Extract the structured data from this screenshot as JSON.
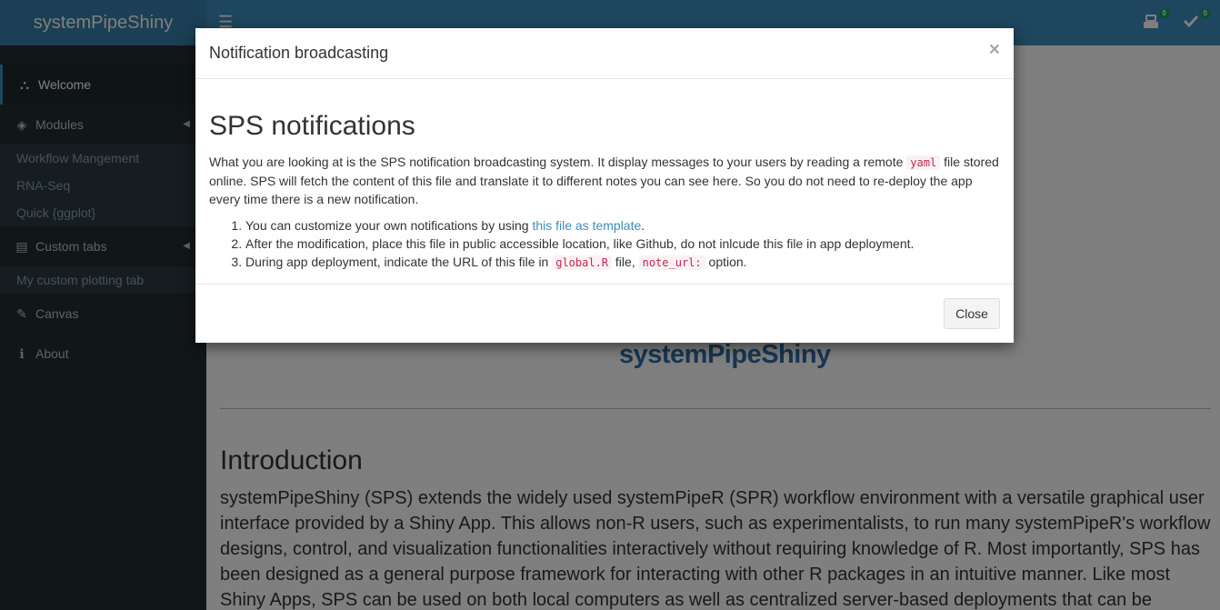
{
  "app": {
    "title": "systemPipeShiny"
  },
  "header": {
    "toggle_icon": "hamburger-icon",
    "notifications_badge": "0",
    "tasks_badge": "0"
  },
  "sidebar": {
    "items": [
      {
        "label": "Welcome",
        "icon": "sitemap-icon",
        "active": true
      },
      {
        "label": "Modules",
        "icon": "layers-icon"
      },
      {
        "label": "Custom tabs",
        "icon": "images-icon"
      },
      {
        "label": "Canvas",
        "icon": "paintbrush-icon"
      },
      {
        "label": "About",
        "icon": "info-icon"
      }
    ],
    "modules_sub": [
      "Workflow Mangement",
      "RNA-Seq",
      "Quick {ggplot}"
    ],
    "custom_sub": [
      "My custom plotting tab"
    ]
  },
  "content": {
    "logo_text": "systemPipeShiny",
    "intro_title": "Introduction",
    "intro_text": "systemPipeShiny (SPS) extends the widely used systemPipeR (SPR) workflow environment with a versatile graphical user interface provided by a Shiny App. This allows non-R users, such as experimentalists, to run many systemPipeR's workflow designs, control, and visualization functionalities interactively without requiring knowledge of R. Most importantly, SPS has been designed as a general purpose framework for interacting with other R packages in an intuitive manner. Like most Shiny Apps, SPS can be used on both local computers as well as centralized server-based deployments that can be"
  },
  "modal": {
    "title": "Notification broadcasting",
    "close_x": "×",
    "heading": "SPS notifications",
    "lead_1": "What you are looking at is the SPS notification broadcasting system. It display messages to your users by reading a remote ",
    "lead_code": "yaml",
    "lead_2": " file stored online. SPS will fetch the content of this file and translate it to different notes you can see here. So you do not need to re-deploy the app every time there is a new notification.",
    "list": {
      "item1_pre": "You can customize your own notifications by using ",
      "item1_link": "this file as template",
      "item1_post": ".",
      "item2": "After the modification, place this file in public accessible location, like Github, do not inlcude this file in app deployment.",
      "item3_pre": "During app deployment, indicate the URL of this file in ",
      "item3_code1": "global.R",
      "item3_mid": " file, ",
      "item3_code2": "note_url:",
      "item3_post": " option."
    },
    "close_button": "Close"
  }
}
